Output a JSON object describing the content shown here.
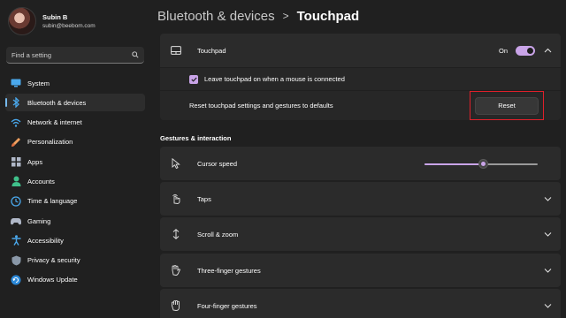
{
  "profile": {
    "name": "Subin B",
    "email": "subin@beebom.com"
  },
  "search": {
    "placeholder": "Find a setting"
  },
  "sidebar": {
    "items": [
      {
        "label": "System",
        "icon": "system-icon"
      },
      {
        "label": "Bluetooth & devices",
        "icon": "bluetooth-icon",
        "active": true
      },
      {
        "label": "Network & internet",
        "icon": "wifi-icon"
      },
      {
        "label": "Personalization",
        "icon": "brush-icon"
      },
      {
        "label": "Apps",
        "icon": "apps-icon"
      },
      {
        "label": "Accounts",
        "icon": "person-icon"
      },
      {
        "label": "Time & language",
        "icon": "globe-clock-icon"
      },
      {
        "label": "Gaming",
        "icon": "controller-icon"
      },
      {
        "label": "Accessibility",
        "icon": "accessibility-icon"
      },
      {
        "label": "Privacy & security",
        "icon": "shield-icon"
      },
      {
        "label": "Windows Update",
        "icon": "update-icon"
      }
    ]
  },
  "breadcrumb": {
    "parent": "Bluetooth & devices",
    "separator": ">",
    "current": "Touchpad"
  },
  "touchpad": {
    "label": "Touchpad",
    "state_label": "On",
    "enabled": true,
    "leave_on_label": "Leave touchpad on when a mouse is connected",
    "leave_on_checked": true,
    "reset_label": "Reset touchpad settings and gestures to defaults",
    "reset_button": "Reset"
  },
  "gestures": {
    "section_title": "Gestures & interaction",
    "cursor_speed_label": "Cursor speed",
    "cursor_speed_fraction": 0.52,
    "items": [
      {
        "label": "Taps",
        "icon": "tap-icon"
      },
      {
        "label": "Scroll & zoom",
        "icon": "scroll-zoom-icon"
      },
      {
        "label": "Three-finger gestures",
        "icon": "three-finger-icon"
      },
      {
        "label": "Four-finger gestures",
        "icon": "four-finger-icon"
      }
    ]
  },
  "colors": {
    "accent": "#c9a4e8",
    "nav_indicator": "#76b9ed",
    "highlight_box": "#e0202a",
    "background": "#202020",
    "card": "#2b2b2b"
  }
}
